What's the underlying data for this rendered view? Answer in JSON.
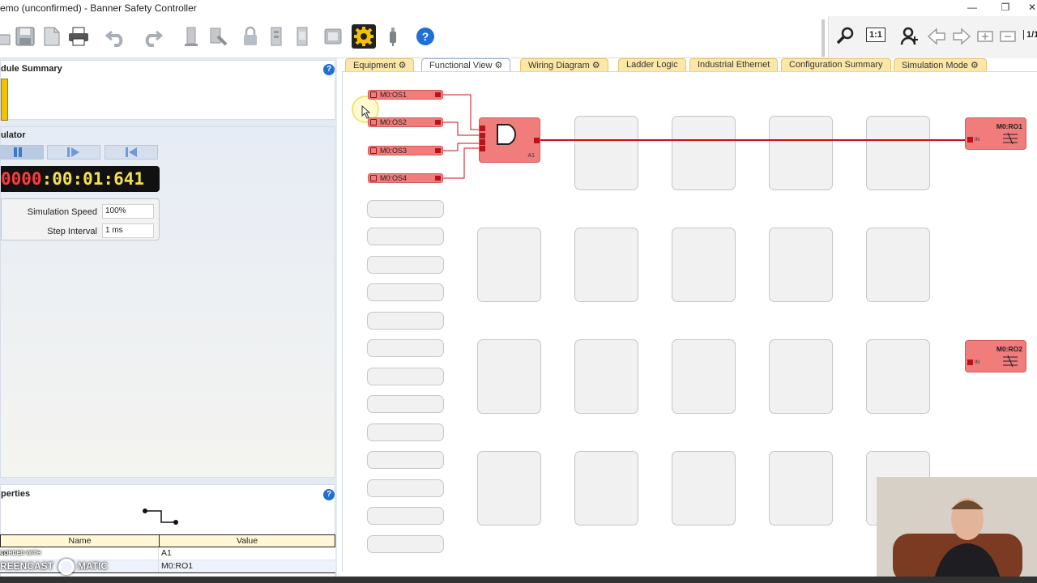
{
  "window": {
    "title": "emo (unconfirmed) - Banner Safety Controller",
    "minimize": "—",
    "restore": "❐",
    "close": "✕"
  },
  "toolbar": {
    "zoom_fit_label": "1:1",
    "page_label": "1/1"
  },
  "module_summary": {
    "title": "dule Summary"
  },
  "simulator": {
    "title": "ulator",
    "clock": {
      "red_part": "0000",
      "yellow_part": ":00:01:641"
    },
    "speed_label": "Simulation Speed",
    "speed_value": "100%",
    "step_label": "Step Interval",
    "step_value": "1 ms",
    "splitter": "....."
  },
  "properties": {
    "title": "perties",
    "columns": [
      "Name",
      "Value"
    ],
    "rows": [
      {
        "name": "m",
        "value": "A1"
      },
      {
        "name": "",
        "value": "M0:RO1"
      }
    ]
  },
  "tabs": [
    {
      "label": "Equipment",
      "gear": "⚙"
    },
    {
      "label": "Functional View",
      "gear": "⚙"
    },
    {
      "label": "Wiring Diagram",
      "gear": "⚙"
    },
    {
      "label": "Ladder Logic",
      "gear": ""
    },
    {
      "label": "Industrial Ethernet",
      "gear": ""
    },
    {
      "label": "Configuration Summary",
      "gear": ""
    },
    {
      "label": "Simulation Mode",
      "gear": "⚙"
    }
  ],
  "inputs": [
    "M0:OS1",
    "M0:OS2",
    "M0:OS3",
    "M0:OS4"
  ],
  "logic_block": {
    "label": "A1"
  },
  "outputs": [
    {
      "label": "M0:RO1",
      "pin": "IN"
    },
    {
      "label": "M0:RO2",
      "pin": "IN"
    }
  ],
  "watermark": {
    "line1": "CORDED WITH",
    "line2": "REENCAST",
    "line3": "MATIC"
  },
  "colors": {
    "accent_tab": "#fde7a8",
    "signal_red": "#d10d18",
    "block_red": "#f07c7c"
  }
}
